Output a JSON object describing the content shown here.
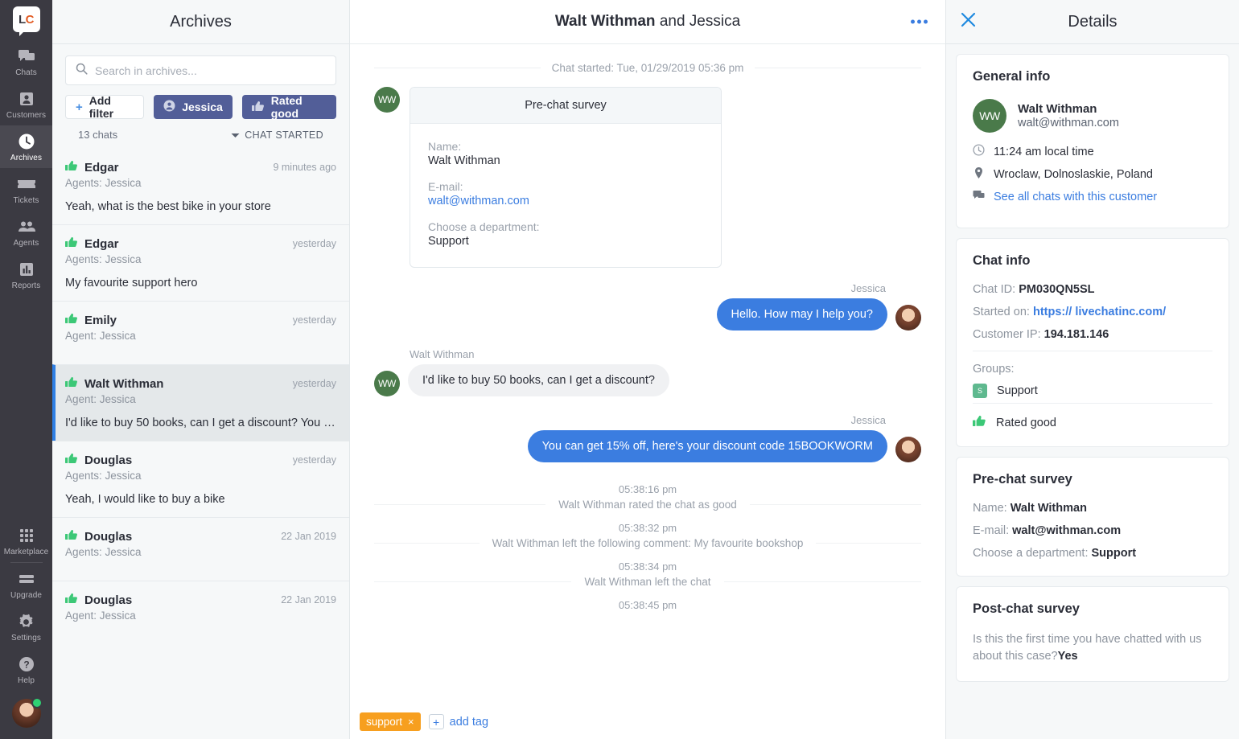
{
  "rail": {
    "logo": "LC",
    "items": [
      {
        "label": "Chats",
        "icon": "chats-icon",
        "active": false
      },
      {
        "label": "Customers",
        "icon": "customers-icon",
        "active": false
      },
      {
        "label": "Archives",
        "icon": "archives-clock-icon",
        "active": true
      },
      {
        "label": "Tickets",
        "icon": "tickets-icon",
        "active": false
      },
      {
        "label": "Agents",
        "icon": "agents-icon",
        "active": false
      },
      {
        "label": "Reports",
        "icon": "reports-bars-icon",
        "active": false
      }
    ],
    "bottom_items": [
      {
        "label": "Marketplace",
        "icon": "marketplace-grid-icon"
      },
      {
        "label": "Upgrade",
        "icon": "upgrade-icon"
      },
      {
        "label": "Settings",
        "icon": "gear-icon"
      },
      {
        "label": "Help",
        "icon": "help-question-icon"
      }
    ],
    "avatar_status": "online"
  },
  "archives": {
    "title": "Archives",
    "search_placeholder": "Search in archives...",
    "add_filter_label": "Add filter",
    "filters": [
      {
        "label": "Jessica",
        "icon": "person-icon"
      },
      {
        "label": "Rated good",
        "icon": "thumb-up-icon"
      }
    ],
    "count_label": "13 chats",
    "sort_label": "CHAT STARTED",
    "rows": [
      {
        "name": "Edgar",
        "time": "9 minutes ago",
        "agents": "Agents: Jessica",
        "preview": "Yeah, what is the best bike in your store",
        "rating": "good",
        "selected": false
      },
      {
        "name": "Edgar",
        "time": "yesterday",
        "agents": "Agents: Jessica",
        "preview": "My favourite support hero",
        "rating": "good",
        "selected": false
      },
      {
        "name": "Emily",
        "time": "yesterday",
        "agents": "Agent: Jessica",
        "preview": "",
        "rating": "good",
        "selected": false
      },
      {
        "name": "Walt Withman",
        "time": "yesterday",
        "agents": "Agent: Jessica",
        "preview": "I'd like to buy 50 books, can I get a discount? You …",
        "rating": "good",
        "selected": true
      },
      {
        "name": "Douglas",
        "time": "yesterday",
        "agents": "Agents: Jessica",
        "preview": "Yeah, I would like to buy a bike",
        "rating": "good",
        "selected": false
      },
      {
        "name": "Douglas",
        "time": "22 Jan 2019",
        "agents": "Agents: Jessica",
        "preview": "",
        "rating": "good",
        "selected": false
      },
      {
        "name": "Douglas",
        "time": "22 Jan 2019",
        "agents": "Agent: Jessica",
        "preview": "",
        "rating": "good",
        "selected": false
      }
    ]
  },
  "chat": {
    "title_customer": "Walt Withman",
    "title_rest": " and Jessica",
    "menu_icon": "more-options-icon",
    "started_label": "Chat started: Tue, 01/29/2019 05:36 pm",
    "survey": {
      "header": "Pre-chat survey",
      "fields": [
        {
          "q": "Name:",
          "a": "Walt Withman",
          "link": false
        },
        {
          "q": "E-mail:",
          "a": "walt@withman.com",
          "link": true
        },
        {
          "q": "Choose a department:",
          "a": "Support",
          "link": false
        }
      ]
    },
    "customer_initials": "WW",
    "messages": [
      {
        "side": "right",
        "sender": "Jessica",
        "text": "Hello. How may I help you?"
      },
      {
        "side": "left",
        "sender": "Walt Withman",
        "text": "I'd like to buy 50 books, can I get a discount?"
      },
      {
        "side": "right",
        "sender": "Jessica",
        "text": "You can get 15% off, here's your discount code 15BOOKWORM"
      }
    ],
    "events": [
      {
        "time": "05:38:16 pm",
        "text": "Walt Withman rated the chat as good"
      },
      {
        "time": "05:38:32 pm",
        "text": "Walt Withman left the following comment: My favourite bookshop"
      },
      {
        "time": "05:38:34 pm",
        "text": "Walt Withman left the chat"
      },
      {
        "time": "05:38:45 pm",
        "text": ""
      }
    ],
    "tags": [
      {
        "label": "support",
        "remove": "×"
      }
    ],
    "add_tag_label": "add tag",
    "add_tag_plus": "+"
  },
  "details": {
    "title": "Details",
    "close_icon": "close-icon",
    "general": {
      "heading": "General info",
      "initials": "WW",
      "name": "Walt Withman",
      "email": "walt@withman.com",
      "local_time": "11:24 am local time",
      "location": "Wroclaw, Dolnoslaskie, Poland",
      "see_all_label": "See all chats with this customer"
    },
    "chat_info": {
      "heading": "Chat info",
      "chat_id_label": "Chat ID:",
      "chat_id": "PM030QN5SL",
      "started_on_label": "Started on:",
      "started_on": "https:// livechatinc.com/",
      "ip_label": "Customer IP:",
      "ip": "194.181.146",
      "groups_label": "Groups:",
      "group_badge": "S",
      "group_name": "Support",
      "rating": "Rated good"
    },
    "pre_survey": {
      "heading": "Pre-chat survey",
      "rows": [
        {
          "q": "Name:",
          "a": "Walt Withman"
        },
        {
          "q": "E-mail:",
          "a": "walt@withman.com"
        },
        {
          "q": "Choose a department:",
          "a": "Support"
        }
      ]
    },
    "post_survey": {
      "heading": "Post-chat survey",
      "q1": "Is this the first time you have chatted with us about this case?",
      "a1": "Yes"
    }
  },
  "colors": {
    "accent_blue": "#3b7de0",
    "filter_chip": "#525e98",
    "rail_bg": "#3b3a42",
    "panel_bg": "#f6f8f9",
    "tag_orange": "#f79f1f",
    "thumb_green": "#3cc877",
    "avatar_green": "#4a7a4a"
  }
}
